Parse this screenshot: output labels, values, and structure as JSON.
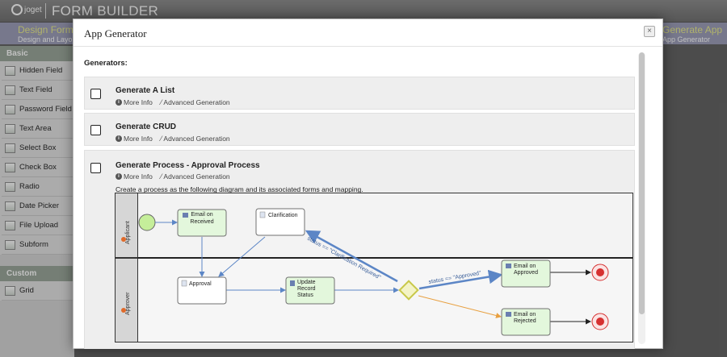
{
  "app": {
    "logo_text": "joget",
    "title": "FORM BUILDER"
  },
  "steps": {
    "left": {
      "title": "Design Form",
      "subtitle": "Design and Layout"
    },
    "right": {
      "title": "Generate App",
      "subtitle": "App Generator"
    }
  },
  "sidebar": {
    "basic_header": "Basic",
    "basic_items": [
      {
        "label": "Hidden Field",
        "icon": "hidden-field-icon"
      },
      {
        "label": "Text Field",
        "icon": "text-field-icon"
      },
      {
        "label": "Password Field",
        "icon": "password-field-icon"
      },
      {
        "label": "Text Area",
        "icon": "text-area-icon"
      },
      {
        "label": "Select Box",
        "icon": "select-box-icon"
      },
      {
        "label": "Check Box",
        "icon": "check-box-icon"
      },
      {
        "label": "Radio",
        "icon": "radio-icon"
      },
      {
        "label": "Date Picker",
        "icon": "date-picker-icon"
      },
      {
        "label": "File Upload",
        "icon": "file-upload-icon"
      },
      {
        "label": "Subform",
        "icon": "subform-icon"
      }
    ],
    "custom_header": "Custom",
    "custom_items": [
      {
        "label": "Grid",
        "icon": "grid-icon"
      }
    ]
  },
  "dialog": {
    "title": "App Generator",
    "close_label": "×",
    "generators_label": "Generators:",
    "generators": [
      {
        "title": "Generate A List",
        "more_info": "More Info",
        "advanced": "Advanced Generation"
      },
      {
        "title": "Generate CRUD",
        "more_info": "More Info",
        "advanced": "Advanced Generation"
      },
      {
        "title": "Generate Process - Approval Process",
        "more_info": "More Info",
        "advanced": "Advanced Generation",
        "description": "Create a process as the following diagram and its associated forms and mapping."
      }
    ],
    "diagram": {
      "lane_applicant": "Applicant",
      "lane_approver": "Approver",
      "node_email_received": [
        "Email on",
        "Received"
      ],
      "node_clarification": "Clarification",
      "node_approval": "Approval",
      "node_update_record": [
        "Update",
        "Record",
        "Status"
      ],
      "node_email_approved": [
        "Email on",
        "Approved"
      ],
      "node_email_rejected": [
        "Email on",
        "Rejected"
      ],
      "label_clarification": "status == \"Clarification Required\"",
      "label_approved": "status == \"Approved\""
    }
  },
  "colors": {
    "task_fill": "#e3f7dc",
    "task_border": "#707070",
    "gateway": "#c8c84a",
    "flow": "#5c86c6",
    "end_event": "#d63030",
    "start_event": "#c5ee9a"
  }
}
